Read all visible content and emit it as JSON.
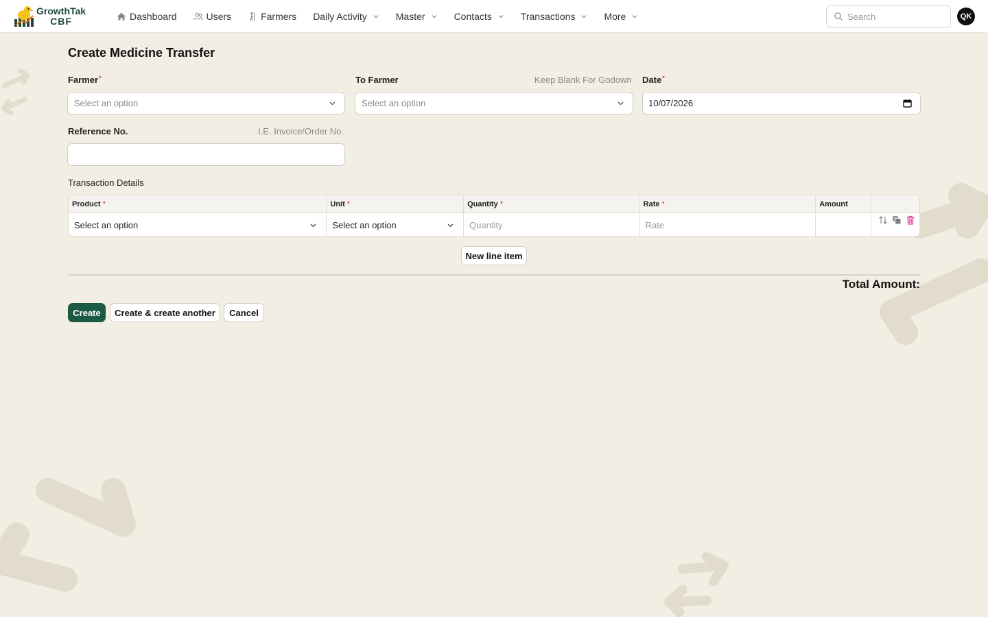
{
  "app": {
    "brand_name": "GrowthTak",
    "brand_sub": "CBF"
  },
  "nav": {
    "items": [
      {
        "label": "Dashboard",
        "icon": "home-icon"
      },
      {
        "label": "Users",
        "icon": "users-icon"
      },
      {
        "label": "Farmers",
        "icon": "farmer-icon"
      },
      {
        "label": "Daily Activity",
        "icon": "chevron-down-icon"
      },
      {
        "label": "Master",
        "icon": "chevron-down-icon"
      },
      {
        "label": "Contacts",
        "icon": "chevron-down-icon"
      },
      {
        "label": "Transactions",
        "icon": "chevron-down-icon"
      },
      {
        "label": "More",
        "icon": "chevron-down-icon"
      }
    ]
  },
  "search": {
    "placeholder": "Search"
  },
  "user": {
    "initials": "QK"
  },
  "page": {
    "title": "Create Medicine Transfer"
  },
  "form": {
    "farmer": {
      "label": "Farmer",
      "placeholder": "Select an option"
    },
    "to_farmer": {
      "label": "To Farmer",
      "hint": "Keep Blank For Godown",
      "placeholder": "Select an option"
    },
    "date": {
      "label": "Date",
      "value": "10/07/2026"
    },
    "reference": {
      "label": "Reference No.",
      "hint": "I.E. Invoice/Order No.",
      "value": ""
    }
  },
  "transaction_details": {
    "label": "Transaction Details",
    "columns": {
      "product": "Product",
      "unit": "Unit",
      "quantity": "Quantity",
      "rate": "Rate",
      "amount": "Amount"
    },
    "row": {
      "product": "Select an option",
      "unit": "Select an option",
      "quantity_placeholder": "Quantity",
      "rate_placeholder": "Rate",
      "amount": ""
    },
    "new_line_label": "New line item"
  },
  "total": {
    "label": "Total Amount:"
  },
  "actions": {
    "create": "Create",
    "create_another": "Create & create another",
    "cancel": "Cancel"
  },
  "colors": {
    "background": "#f3eee3",
    "primary": "#1b5a45",
    "required": "#d23c3c",
    "delete": "#e34f9c"
  }
}
